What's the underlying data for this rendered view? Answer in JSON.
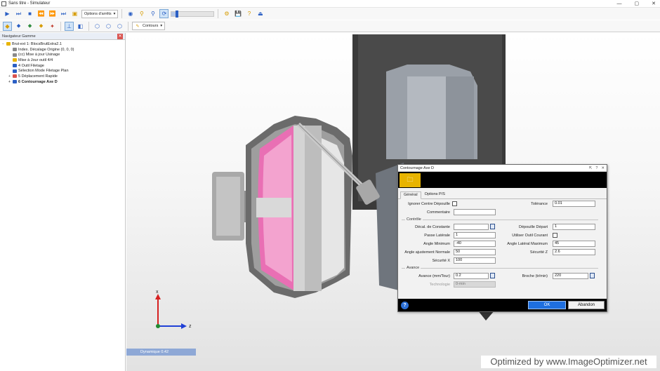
{
  "window": {
    "title": "Sans titre - Simulateur",
    "controls": [
      "—",
      "▢",
      "✕"
    ]
  },
  "toolbar1": {
    "options_label": "Options d'arrêts",
    "speed_fraction": 0.12
  },
  "toolbar2": {
    "contours_label": "Contours"
  },
  "tree_panel": {
    "title": "Navigateur Gamme",
    "close": "✕",
    "items": [
      {
        "toggle": "−",
        "label": "Brut-ext 1: BlocsBrutExtra2.1",
        "indent": 0,
        "color": "#e8b400",
        "bold": false
      },
      {
        "toggle": "",
        "label": "Index. Décalage Origine (0, 0, 0)",
        "indent": 1,
        "color": "#8a8a8a",
        "bold": false
      },
      {
        "toggle": "",
        "label": "(cc) Mise à jour Usinage",
        "indent": 1,
        "color": "#8a8a8a",
        "bold": false
      },
      {
        "toggle": "",
        "label": "Mise à Jour outil 4/4",
        "indent": 1,
        "color": "#e8b400",
        "bold": false
      },
      {
        "toggle": "",
        "label": "4 Outil Filetage",
        "indent": 1,
        "color": "#2b5fc4",
        "bold": false
      },
      {
        "toggle": "",
        "label": "Sélection Mode Filetage Plan",
        "indent": 1,
        "color": "#2b5fc4",
        "bold": false
      },
      {
        "toggle": "+",
        "label": "5 Déplacement Rapide",
        "indent": 1,
        "color": "#d9534f",
        "bold": false
      },
      {
        "toggle": "+",
        "label": "6 Contournage Axe D",
        "indent": 1,
        "color": "#2b5fc4",
        "bold": true
      }
    ]
  },
  "viewport": {
    "axis_x": "x",
    "axis_z": "z",
    "status": "Dynamique 0.42"
  },
  "dialog": {
    "title": "Contournage Axe D",
    "title_controls": [
      "⇱",
      "?",
      "✕"
    ],
    "tabs": [
      "Général",
      "Options P/S"
    ],
    "group_contour": "Contrôle",
    "group_avance": "Avance",
    "fields": {
      "ignorer_label": "Ignorer Centre Dépouille",
      "tolerance_label": "Tolérance",
      "tolerance_value": "0.01",
      "commentaire_label": "Commentaire",
      "commentaire_value": "",
      "decal_constante_label": "Décal. de Constante",
      "decal_constante_value": "",
      "depouille_depart_label": "Dépouille Départ",
      "depouille_depart_value": "1",
      "passe_laterale_label": "Passe Latérale",
      "passe_laterale_value": "1",
      "utiliser_outil_label": "Utiliser Outil Courant",
      "angle_minimum_label": "Angle Minimum",
      "angle_minimum_value": "-40",
      "angle_lateral_max_label": "Angle Latéral Maximum",
      "angle_lateral_max_value": "45",
      "angle_ajustement_label": "Angle ajustement Normale",
      "angle_ajustement_value": "50",
      "securite_z_label": "Sécurité Z",
      "securite_z_value": "2.6",
      "securite_x_label": "Sécurité X",
      "securite_x_value": "100",
      "avance_label": "Avance (mm/Tour)",
      "avance_value": "0.2",
      "broche_label": "Broche (tr/min)",
      "broche_value": "220",
      "technologie_label": "Technologie",
      "technologie_value": "0-min"
    },
    "ok_label": "OK",
    "cancel_label": "Abandon",
    "help": "?"
  },
  "watermark": "Optimized by www.ImageOptimizer.net"
}
